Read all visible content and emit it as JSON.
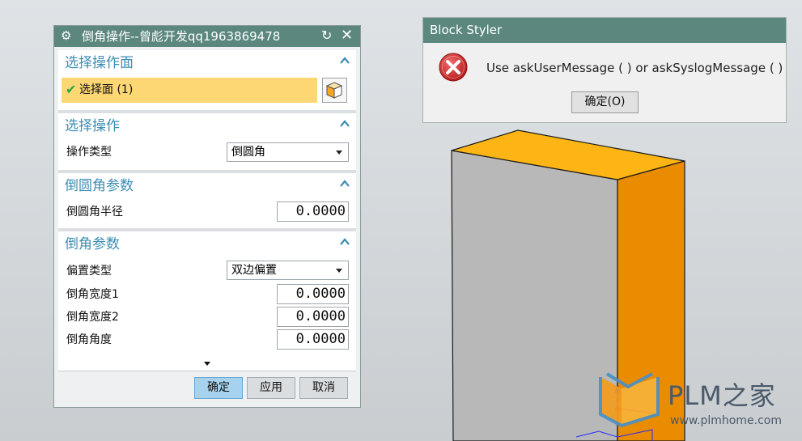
{
  "left_dialog": {
    "title": "倒角操作--曾彪开发qq1963869478",
    "groups": {
      "select_face": {
        "header": "选择操作面",
        "selection_label": "选择面 (1)"
      },
      "select_op": {
        "header": "选择操作",
        "op_type_label": "操作类型",
        "op_type_value": "倒圆角"
      },
      "fillet_params": {
        "header": "倒圆角参数",
        "radius_label": "倒圆角半径",
        "radius_value": "0.0000"
      },
      "chamfer_params": {
        "header": "倒角参数",
        "offset_type_label": "偏置类型",
        "offset_type_value": "双边偏置",
        "width1_label": "倒角宽度1",
        "width1_value": "0.0000",
        "width2_label": "倒角宽度2",
        "width2_value": "0.0000",
        "angle_label": "倒角角度",
        "angle_value": "0.0000"
      }
    },
    "buttons": {
      "ok": "确定",
      "apply": "应用",
      "cancel": "取消"
    }
  },
  "message_box": {
    "title": "Block Styler",
    "message": "Use askUserMessage ( ) or askSyslogMessage ( )",
    "ok_button": "确定(O)"
  },
  "watermark": {
    "brand": "PLM之家",
    "url": "www.plmhome.com"
  },
  "colors": {
    "title_bar": "#5b877f",
    "group_header": "#3d8db3",
    "selection_highlight": "#fdd774",
    "box_top": "#fdb515",
    "box_side": "#ea8c00",
    "box_front": "#b7b7b7"
  }
}
